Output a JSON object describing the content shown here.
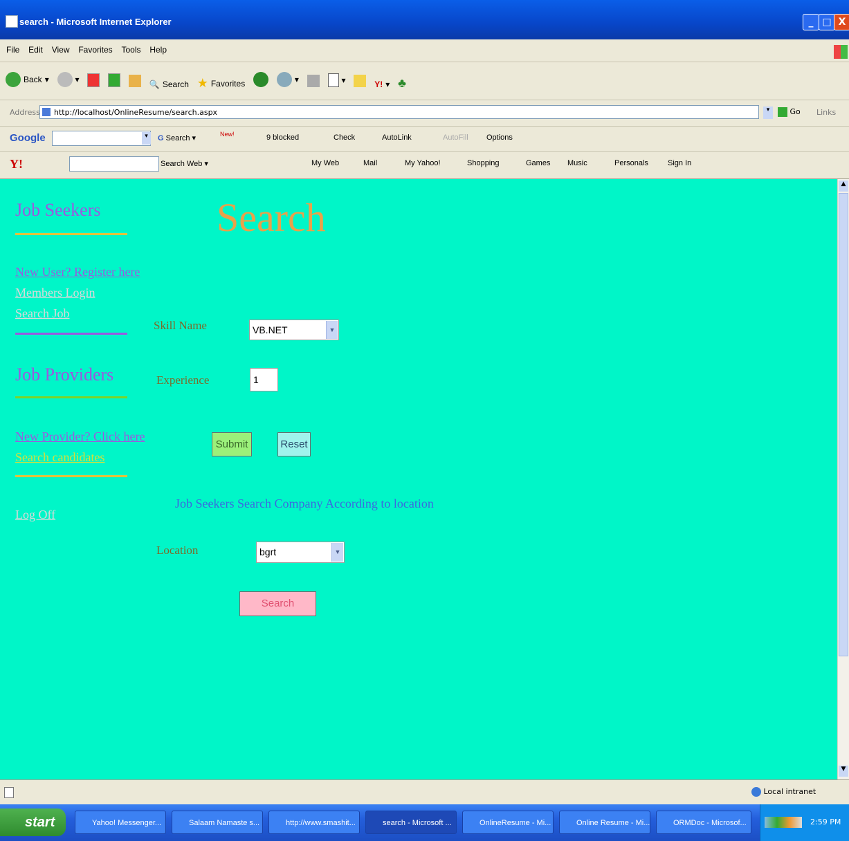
{
  "window": {
    "title": "search - Microsoft Internet Explorer"
  },
  "menu": [
    "File",
    "Edit",
    "View",
    "Favorites",
    "Tools",
    "Help"
  ],
  "toolbar": {
    "back": "Back",
    "search": "Search",
    "favorites": "Favorites"
  },
  "address": {
    "label": "Address",
    "url": "http://localhost/OnlineResume/search.aspx",
    "go": "Go",
    "links": "Links"
  },
  "googlebar": {
    "brand": "Google",
    "search": "Search",
    "new": "New!",
    "blocked": "9 blocked",
    "check": "Check",
    "autolink": "AutoLink",
    "autofill": "AutoFill",
    "options": "Options"
  },
  "yahoobar": {
    "brand": "Y!",
    "searchweb": "Search Web",
    "myweb": "My Web",
    "mail": "Mail",
    "myyahoo": "My Yahoo!",
    "shopping": "Shopping",
    "games": "Games",
    "music": "Music",
    "personals": "Personals",
    "signin": "Sign In"
  },
  "sidebar": {
    "job_seekers_heading": "Job Seekers",
    "new_user_link": "New User? Register here",
    "members_login_link": "Members Login",
    "search_job_link": "Search Job",
    "job_providers_heading": "Job Providers",
    "new_provider_link": "New Provider? Click here",
    "search_candidates_link": "Search candidates",
    "log_off_link": "Log Off"
  },
  "main": {
    "page_title": "Search",
    "skill_label": "Skill Name",
    "skill_value": "VB.NET",
    "experience_label": "Experience",
    "experience_value": "1",
    "submit_label": "Submit",
    "reset_label": "Reset",
    "company_search_heading": "Job Seekers Search Company According to location",
    "location_label": "Location",
    "location_value": "bgrt",
    "search_button_label": "Search"
  },
  "status": {
    "zone": "Local intranet"
  },
  "taskbar": {
    "start": "start",
    "tasks": [
      "Yahoo! Messenger...",
      "Salaam Namaste s...",
      "http://www.smashit...",
      "search - Microsoft ...",
      "OnlineResume - Mi...",
      "Online Resume - Mi...",
      "ORMDoc - Microsof..."
    ],
    "clock": "2:59 PM"
  },
  "colors": {
    "content_bg": "#00f6c8",
    "heading": "#9b58e0",
    "title": "#e8a24a"
  }
}
